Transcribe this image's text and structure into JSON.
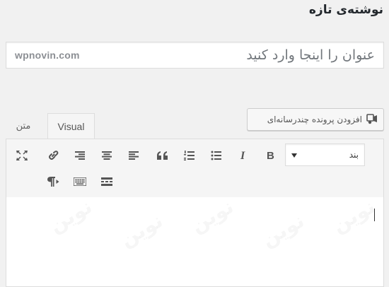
{
  "page": {
    "title": "نوشته‌ی تازه"
  },
  "title_field": {
    "placeholder": "عنوان را اینجا وارد کنید",
    "watermark_text": "wpnovin.com"
  },
  "media_button": {
    "label": "افزودن پرونده چندرسانه‌ای",
    "icon": "media-icon"
  },
  "editor_tabs": [
    {
      "label": "Visual",
      "active": true
    },
    {
      "label": "متن",
      "active": false
    }
  ],
  "toolbar": {
    "format_select": {
      "value": "بند"
    },
    "row1": [
      {
        "name": "bold-button",
        "icon": "bold-icon"
      },
      {
        "name": "italic-button",
        "icon": "italic-icon"
      },
      {
        "name": "bullet-list-button",
        "icon": "bullet-list-icon"
      },
      {
        "name": "numbered-list-button",
        "icon": "numbered-list-icon"
      },
      {
        "name": "blockquote-button",
        "icon": "blockquote-icon"
      },
      {
        "name": "align-left-button",
        "icon": "align-left-icon"
      },
      {
        "name": "align-center-button",
        "icon": "align-center-icon"
      },
      {
        "name": "align-right-button",
        "icon": "align-right-icon"
      },
      {
        "name": "insert-link-button",
        "icon": "link-icon"
      },
      {
        "name": "fullscreen-button",
        "icon": "fullscreen-icon"
      }
    ],
    "row2": [
      {
        "name": "read-more-button",
        "icon": "read-more-icon"
      },
      {
        "name": "toolbar-toggle-button",
        "icon": "keyboard-icon"
      },
      {
        "name": "text-direction-button",
        "icon": "ltr-paragraph-icon"
      }
    ]
  },
  "content": {
    "watermark": "نوین"
  },
  "colors": {
    "background": "#f1f1f1",
    "toolbar": "#f5f5f5",
    "border": "#dddddd",
    "icon": "#555555"
  }
}
